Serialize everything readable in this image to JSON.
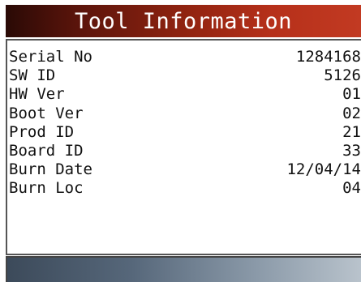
{
  "header": {
    "title": "Tool Information"
  },
  "info": {
    "rows": [
      {
        "label": "Serial No",
        "value": "1284168"
      },
      {
        "label": "SW ID",
        "value": "5126"
      },
      {
        "label": "HW Ver",
        "value": "01"
      },
      {
        "label": "Boot Ver",
        "value": "02"
      },
      {
        "label": "Prod ID",
        "value": "21"
      },
      {
        "label": "Board ID",
        "value": "33"
      },
      {
        "label": "Burn Date",
        "value": "12/04/14"
      },
      {
        "label": "Burn Loc",
        "value": "04"
      }
    ]
  },
  "colors": {
    "title_bar_start": "#2a0a06",
    "title_bar_end": "#c23a22",
    "bottom_bar_start": "#3c4a5a",
    "bottom_bar_end": "#b9c3cc"
  }
}
